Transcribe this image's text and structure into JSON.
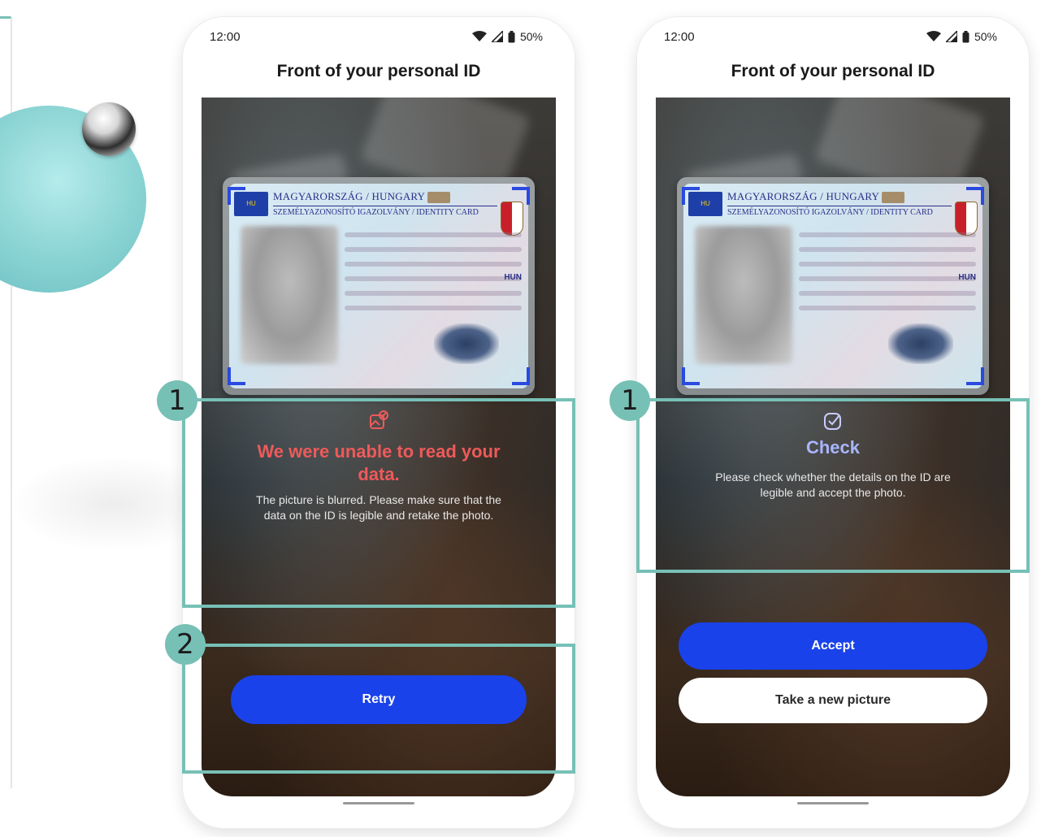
{
  "status_bar": {
    "time": "12:00",
    "battery": "50%"
  },
  "screen_title": "Front of your personal ID",
  "id_card": {
    "country_line": "MAGYARORSZÁG / HUNGARY",
    "document_line": "SZEMÉLYAZONOSÍTÓ IGAZOLVÁNY / IDENTITY CARD",
    "eu_code": "HU",
    "nationality": "HUN"
  },
  "error_screen": {
    "title": "We were unable to read your data.",
    "body": "The picture is blurred. Please make sure that the data on the ID is legible and retake the photo.",
    "retry_label": "Retry"
  },
  "check_screen": {
    "title": "Check",
    "body": "Please check whether the details on the ID are legible and accept the photo.",
    "accept_label": "Accept",
    "new_picture_label": "Take a new picture"
  },
  "annotations": {
    "badge_1": "1",
    "badge_2": "2"
  },
  "colors": {
    "accent": "#1a42ea",
    "error": "#ee5a5a",
    "annotation": "#77c0b6",
    "check_title": "#a9b6ff"
  }
}
